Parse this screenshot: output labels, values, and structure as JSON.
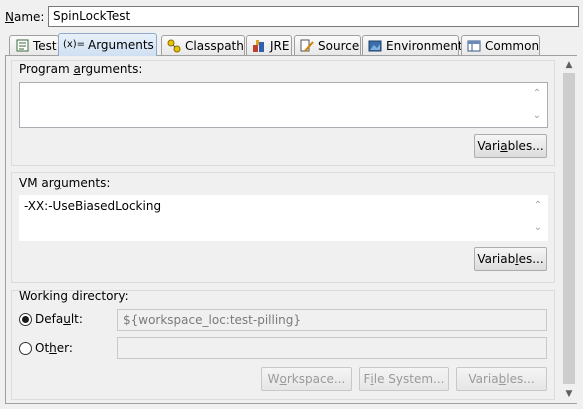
{
  "name": {
    "label": "Name:",
    "value": "SpinLockTest"
  },
  "tabs": [
    {
      "label": "Test",
      "icon": "test-icon"
    },
    {
      "label": "Arguments",
      "icon": "arguments-icon",
      "active": true
    },
    {
      "label": "Classpath",
      "icon": "classpath-icon"
    },
    {
      "label": "JRE",
      "icon": "jre-icon"
    },
    {
      "label": "Source",
      "icon": "source-icon"
    },
    {
      "label": "Environment",
      "icon": "environment-icon"
    },
    {
      "label": "Common",
      "icon": "common-icon"
    }
  ],
  "program_arguments": {
    "title": "Program arguments:",
    "value": "",
    "variables_button": "Variables..."
  },
  "vm_arguments": {
    "title": "VM arguments:",
    "value": "-XX:-UseBiasedLocking",
    "variables_button": "Variables..."
  },
  "working_directory": {
    "title": "Working directory:",
    "default_label": "Default:",
    "default_value": "${workspace_loc:test-pilling}",
    "other_label": "Other:",
    "other_value": "",
    "workspace_button": "Workspace...",
    "filesystem_button": "File System...",
    "variables_button": "Variables...",
    "selected": "default"
  },
  "colors": {
    "active_tab": "#cfe0f3",
    "background": "#f0f0f0"
  }
}
